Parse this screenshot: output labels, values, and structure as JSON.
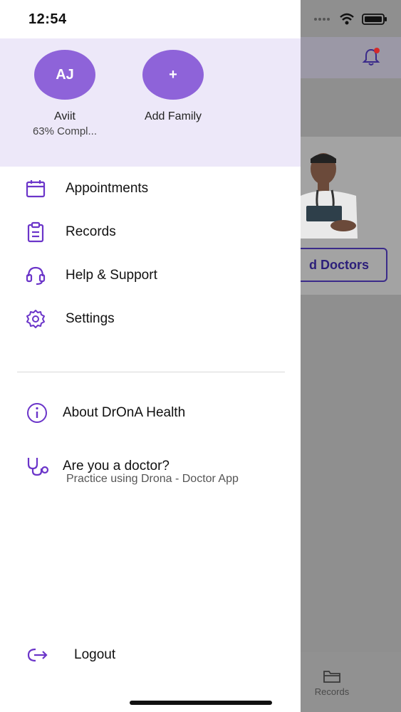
{
  "status_bar": {
    "time": "12:54"
  },
  "background": {
    "button_label": "d Doctors",
    "bottom_tab_label": "Records"
  },
  "drawer": {
    "profiles": [
      {
        "initials": "AJ",
        "name": "Aviit",
        "subtitle": "63% Compl..."
      },
      {
        "initials": "+",
        "name": "Add Family"
      }
    ],
    "menu": [
      {
        "label": "Appointments",
        "icon": "calendar-icon"
      },
      {
        "label": "Records",
        "icon": "clipboard-icon"
      },
      {
        "label": "Help & Support",
        "icon": "headset-icon"
      },
      {
        "label": "Settings",
        "icon": "gear-icon"
      }
    ],
    "about": {
      "label": "About DrOnA Health",
      "icon": "info-icon"
    },
    "doctor": {
      "label": "Are you a doctor?",
      "subtitle": "Practice using Drona - Doctor App",
      "icon": "stethoscope-icon"
    },
    "logout": {
      "label": "Logout",
      "icon": "logout-icon"
    }
  },
  "colors": {
    "accent": "#8e63d9",
    "icon": "#6b35c9",
    "profile_bg": "#ede8f9"
  }
}
